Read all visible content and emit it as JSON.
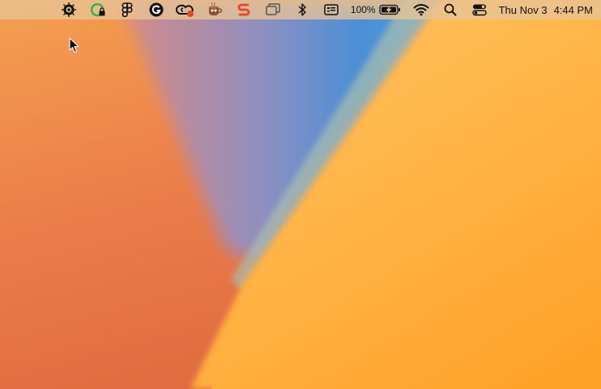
{
  "menubar": {
    "status_icons": [
      {
        "name": "eye-settings-icon"
      },
      {
        "name": "green-lock-icon"
      },
      {
        "name": "figma-icon"
      },
      {
        "name": "grammarly-icon"
      },
      {
        "name": "creative-cloud-icon"
      },
      {
        "name": "coffee-cup-icon"
      },
      {
        "name": "red-s-icon"
      },
      {
        "name": "window-stack-icon"
      },
      {
        "name": "bluetooth-icon"
      },
      {
        "name": "input-source-icon"
      }
    ],
    "battery": {
      "percent_label": "100%",
      "level": 1.0,
      "charging": true
    },
    "wifi_icon": "wifi-icon",
    "search_icon": "spotlight-search-icon",
    "control_center_icon": "control-center-icon",
    "clock": {
      "date": "Thu Nov 3",
      "time": "4:44 PM"
    }
  },
  "colors": {
    "wallpaper_orange": "#f59a3c",
    "wallpaper_blue": "#4a8fd6",
    "wallpaper_yellow": "#ffb444",
    "wallpaper_red_orange": "#e06a44",
    "accent_green": "#2bb24c",
    "accent_red": "#e8442a"
  }
}
